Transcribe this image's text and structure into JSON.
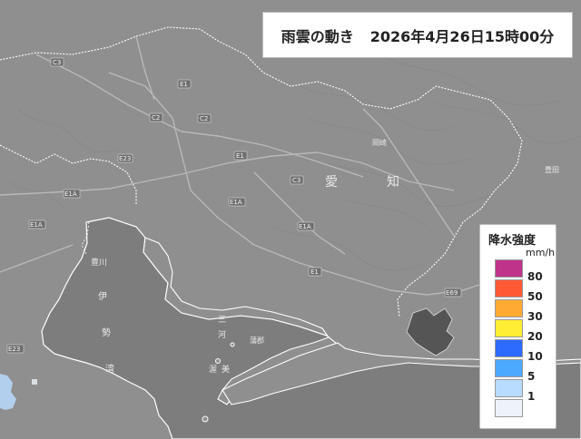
{
  "title": {
    "main": "雨雲の動き",
    "timestamp": "2026年4月26日15時00分"
  },
  "legend": {
    "title": "降水強度",
    "unit": "mm/h",
    "levels": [
      {
        "label": "80",
        "color": "#c0338a"
      },
      {
        "label": "50",
        "color": "#ff5a36"
      },
      {
        "label": "30",
        "color": "#ffab33"
      },
      {
        "label": "20",
        "color": "#ffee33"
      },
      {
        "label": "10",
        "color": "#2d6bff"
      },
      {
        "label": "5",
        "color": "#4da8ff"
      },
      {
        "label": "1",
        "color": "#b8dcff"
      },
      {
        "label": "",
        "color": "#eef2fa"
      }
    ]
  },
  "map": {
    "region_chars": [
      "愛",
      "知"
    ],
    "road_badges": [
      "C3",
      "E1",
      "C2",
      "E1A",
      "E23",
      "C2",
      "E1",
      "C3",
      "E1A",
      "E1A",
      "E1",
      "E69",
      "E23",
      "E1A"
    ],
    "place_labels": [
      "豊川",
      "伊",
      "勢",
      "湾",
      "三",
      "河",
      "蒲郡",
      "渥",
      "美",
      "岡崎",
      "豊田"
    ],
    "colors": {
      "land": "#8f8f8f",
      "sea": "#7d7d7d",
      "coastline": "#ffffff",
      "rain_light": "#b8dcff"
    }
  }
}
